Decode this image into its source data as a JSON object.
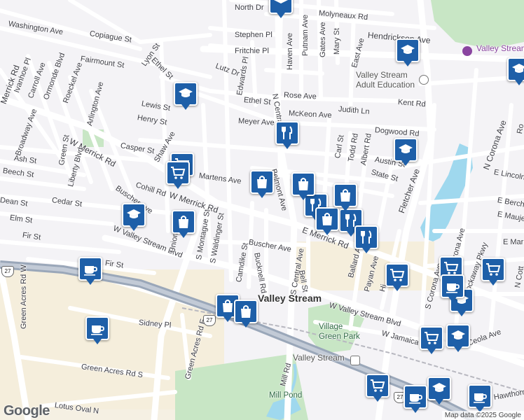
{
  "map": {
    "title_label": "Valley Stream",
    "attribution": "Map data ©2025 Google",
    "logo_text": "Google",
    "colors": {
      "pin": "#1e5fa8",
      "road": "#ffffff",
      "highway": "#9aa7b9",
      "park": "#c8e6c5",
      "water": "#9fd8ee",
      "commercial": "#f5eedc"
    }
  },
  "streets": [
    "North Dr",
    "Molyneaux Rd",
    "Washington Ave",
    "Copiague St",
    "Hendrickson Ave",
    "Stephen Pl",
    "Fritchie Pl",
    "Putnam Ave",
    "Gates Ave",
    "Haven Ave",
    "Mary St",
    "East Ave",
    "Lyon St",
    "Ethel St",
    "Fairmount St",
    "Ivanhoe Pl",
    "Carroll Ave",
    "Ormonde Blvd",
    "Roeckel Ave",
    "Lutz Dr",
    "Edwards Pl",
    "Arlington Ave",
    "Lewis St",
    "Rose Ave",
    "Kent Rd",
    "Ethel St",
    "Henry St",
    "N Central Ave",
    "Meyer Ave",
    "McKeon Ave",
    "Judith Ln",
    "Merrick Rd",
    "Broadway Ave",
    "Dogwood Rd",
    "Casper St",
    "W Merrick Rd",
    "Shaw Ave",
    "Green St",
    "Liberty Blvd",
    "Carl St",
    "Todd Rd",
    "Albert Rd",
    "Austin St",
    "Ash St",
    "Beech St",
    "Martens Ave",
    "Belmont Ave",
    "State St",
    "Fletcher Ave",
    "N Corona Ave",
    "Cohill Rd",
    "Buscher Ave",
    "Cedar St",
    "Dean St",
    "W Merrick Rd",
    "Elm St",
    "Fir St",
    "Fir St",
    "W Valley Stream Blvd",
    "Union Ave",
    "S Montague St",
    "S Waldinger St",
    "Camdike St",
    "Bucknell Rd",
    "S Central Ave",
    "Bell St",
    "Buscher Ave",
    "Ballard Ave",
    "Payan Ave",
    "E Merrick Rd",
    "Rockaway Pkwy",
    "E Maujer",
    "E Berch",
    "Corona Ave",
    "Hi",
    "Green Acres Rd W",
    "Green Acres Rd E",
    "Sidney Pl",
    "W Valley Stream Blvd",
    "Green Acres Rd S",
    "Mill Rd",
    "Lotus Oval N",
    "S Corona Ave",
    "Ceola Ave",
    "W Jamaica Ave",
    "Hawthorn",
    "E Marks",
    "N Cott",
    "E Lincoln",
    "Ro",
    "S Corona Ave"
  ],
  "places": {
    "valley_stream": "Valley Stream",
    "adult_ed": "Valley Stream Adult Education",
    "historical": "Valley Stream Historical",
    "village_green": "Village Green Park",
    "station": "Valley Stream",
    "mill_pond": "Mill Pond"
  },
  "route_shields": [
    "27",
    "27",
    "27"
  ],
  "pins": [
    {
      "type": "school",
      "name": "school-pin"
    },
    {
      "type": "school",
      "name": "school-pin"
    },
    {
      "type": "school",
      "name": "school-pin"
    },
    {
      "type": "school",
      "name": "school-pin"
    },
    {
      "type": "school",
      "name": "school-pin"
    },
    {
      "type": "school",
      "name": "school-pin"
    },
    {
      "type": "school",
      "name": "school-pin"
    },
    {
      "type": "restaurant",
      "name": "restaurant-pin"
    },
    {
      "type": "shopping-bag",
      "name": "shopping-pin"
    },
    {
      "type": "shopping-cart",
      "name": "grocery-pin"
    },
    {
      "type": "cafe",
      "name": "cafe-pin"
    }
  ]
}
